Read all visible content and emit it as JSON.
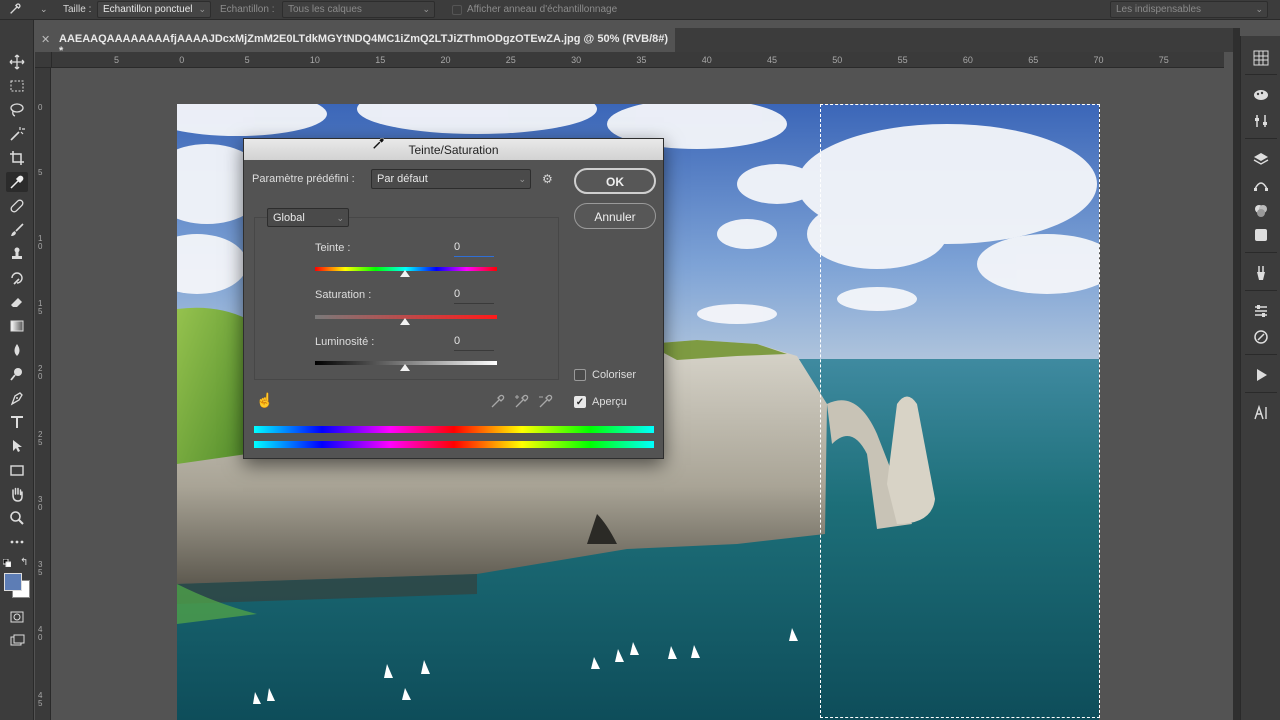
{
  "options_bar": {
    "size_label": "Taille :",
    "size_value": "Echantillon ponctuel",
    "sample_label": "Echantillon :",
    "sample_value": "Tous les calques",
    "show_ring_label": "Afficher anneau d'échantillonnage",
    "workspace": "Les indispensables"
  },
  "document_tab": {
    "title": "AAEAAQAAAAAAAAfjAAAAJDcxMjZmM2E0LTdkMGYtNDQ4MC1iZmQ2LTJiZThmODgzOTEwZA.jpg @ 50% (RVB/8#) *"
  },
  "ruler_top": [
    "5",
    "0",
    "5",
    "10",
    "15",
    "20",
    "25",
    "30",
    "35",
    "40",
    "45",
    "50",
    "55",
    "60",
    "65",
    "70",
    "75"
  ],
  "ruler_left": [
    "0",
    "5",
    "1\n0",
    "1\n5",
    "2\n0",
    "2\n5",
    "3\n0",
    "3\n5",
    "4\n0",
    "4\n5"
  ],
  "dialog": {
    "title": "Teinte/Saturation",
    "preset_label": "Paramètre prédéfini :",
    "preset_value": "Par défaut",
    "channel": "Global",
    "ok": "OK",
    "cancel": "Annuler",
    "hue_label": "Teinte :",
    "hue_value": "0",
    "saturation_label": "Saturation :",
    "saturation_value": "0",
    "lightness_label": "Luminosité :",
    "lightness_value": "0",
    "colorize_label": "Coloriser",
    "colorize_checked": false,
    "preview_label": "Aperçu",
    "preview_checked": true
  },
  "icons": {
    "tools": [
      "move-icon",
      "marquee-icon",
      "lasso-icon",
      "magic-wand-icon",
      "crop-icon",
      "eyedropper-icon",
      "healing-icon",
      "brush-icon",
      "stamp-icon",
      "history-brush-icon",
      "eraser-icon",
      "gradient-icon",
      "blur-icon",
      "dodge-icon",
      "pen-icon",
      "type-icon",
      "path-select-icon",
      "rectangle-icon",
      "hand-icon",
      "zoom-icon",
      "more-icon"
    ],
    "colors": {
      "foreground": "#5d7db5",
      "background": "#ffffff"
    }
  }
}
